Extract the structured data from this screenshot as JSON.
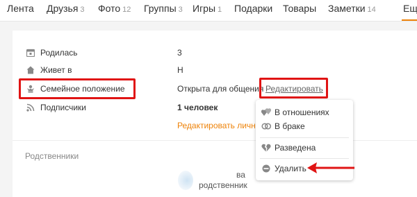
{
  "nav": {
    "items": [
      {
        "label": "Лента",
        "count": ""
      },
      {
        "label": "Друзья",
        "count": "3"
      },
      {
        "label": "Фото",
        "count": "12"
      },
      {
        "label": "Группы",
        "count": "3"
      },
      {
        "label": "Игры",
        "count": "1"
      },
      {
        "label": "Подарки",
        "count": ""
      },
      {
        "label": "Товары",
        "count": ""
      },
      {
        "label": "Заметки",
        "count": "14"
      },
      {
        "label": "Ещ",
        "count": ""
      }
    ]
  },
  "profile": {
    "born_label": "Родилась",
    "born_value": "3",
    "lives_label": "Живет в",
    "lives_value": "Н",
    "family_label": "Семейное положение",
    "family_value": "Открыта для общения",
    "family_edit": "Редактировать",
    "subscribers_label": "Подписчики",
    "subscribers_value": "1 человек",
    "edit_personal": "Редактировать личн"
  },
  "relatives": {
    "title": "Родственники",
    "name_partial": "ва",
    "relation": "родственник"
  },
  "dropdown": {
    "items": [
      "В отношениях",
      "В браке",
      "Разведена",
      "Удалить"
    ]
  },
  "colors": {
    "accent": "#ee8208",
    "highlight_box": "#e01414"
  }
}
